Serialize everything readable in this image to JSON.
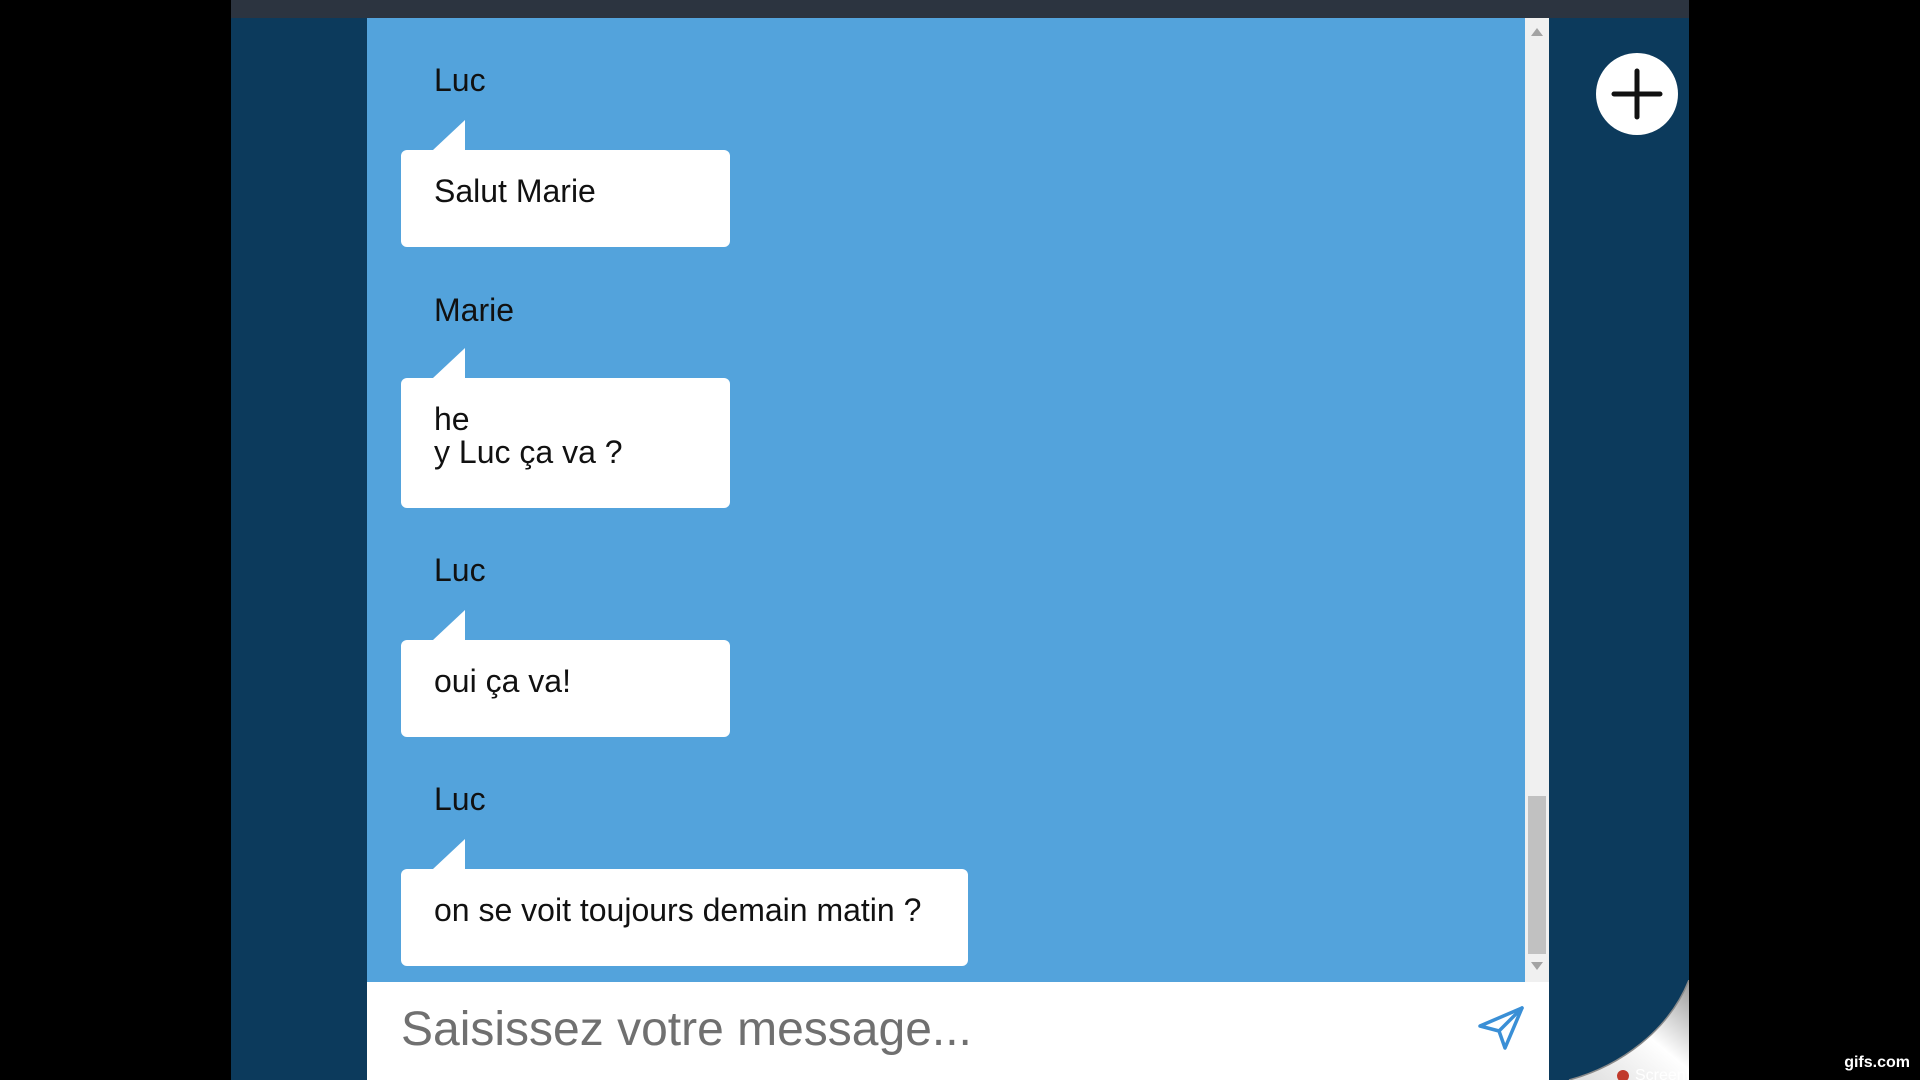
{
  "chat": {
    "messages": [
      {
        "sender": "Luc",
        "text": "Salut Marie"
      },
      {
        "sender": "Marie",
        "text": "he\ny Luc ça va ?"
      },
      {
        "sender": "Luc",
        "text": "oui ça va!"
      },
      {
        "sender": "Luc",
        "text": "on se voit toujours demain matin ?"
      }
    ]
  },
  "composer": {
    "placeholder": "Saisissez votre message...",
    "value": "",
    "send_icon": "send-icon"
  },
  "add_button": {
    "icon": "plus-icon"
  },
  "page_curl": {
    "label": "Screenp"
  },
  "watermark": {
    "text": "gifs.com"
  },
  "colors": {
    "chat_background": "#53a3dc",
    "frame_background": "#0c3a5c",
    "bubble": "#ffffff",
    "icon_accent": "#3a8fd6"
  }
}
